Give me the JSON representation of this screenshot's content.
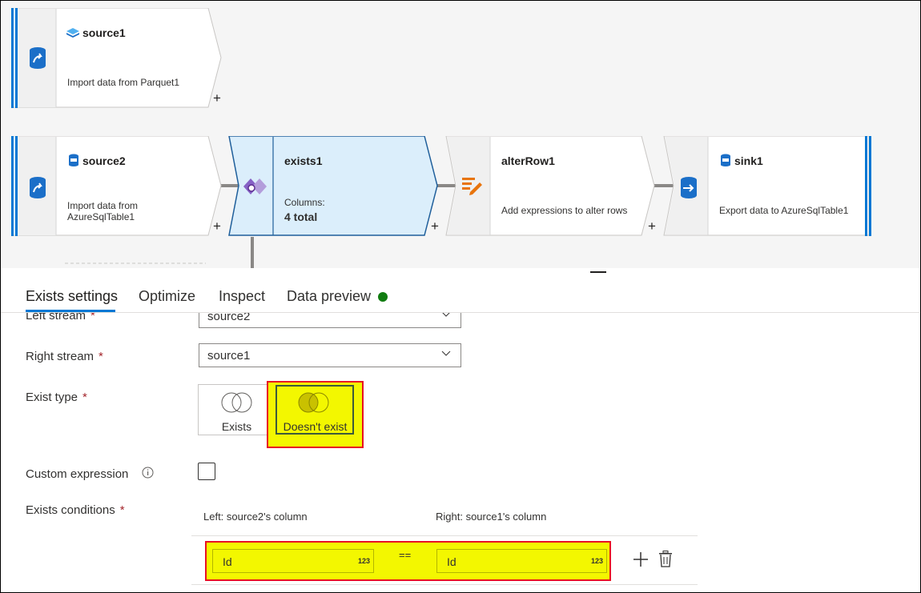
{
  "nodes": {
    "source1": {
      "title": "source1",
      "description": "Import data from Parquet1"
    },
    "source2": {
      "title": "source2",
      "description_line1": "Import data from",
      "description_line2": "AzureSqlTable1"
    },
    "exists1": {
      "title": "exists1",
      "columns_label": "Columns:",
      "columns_value": "4 total"
    },
    "alterRow1": {
      "title": "alterRow1",
      "description": "Add expressions to alter rows"
    },
    "sink1": {
      "title": "sink1",
      "description": "Export data to AzureSqlTable1"
    },
    "add_symbol": "+"
  },
  "tabs": [
    {
      "label": "Exists settings",
      "active": true
    },
    {
      "label": "Optimize",
      "active": false
    },
    {
      "label": "Inspect",
      "active": false
    },
    {
      "label": "Data preview",
      "active": false,
      "status_color": "#107c10"
    }
  ],
  "form": {
    "left_stream": {
      "label": "Left stream",
      "required": "*",
      "value": "source2"
    },
    "right_stream": {
      "label": "Right stream",
      "required": "*",
      "value": "source1"
    },
    "exist_type": {
      "label": "Exist type",
      "required": "*",
      "options": [
        "Exists",
        "Doesn't exist"
      ],
      "selected": "Doesn't exist"
    },
    "custom_expression": {
      "label": "Custom expression",
      "info_icon": "info-icon",
      "checked": false
    },
    "exists_conditions": {
      "label": "Exists conditions",
      "required": "*",
      "left_header": "Left: source2's column",
      "right_header": "Right: source1's column",
      "rows": [
        {
          "left": "Id",
          "left_type": "123",
          "operator": "==",
          "right": "Id",
          "right_type": "123"
        }
      ]
    }
  },
  "colors": {
    "accent": "#0078d4",
    "highlight": "#f3f700",
    "highlight_border": "#e81123",
    "selected_node_fill": "#dbeefb"
  }
}
